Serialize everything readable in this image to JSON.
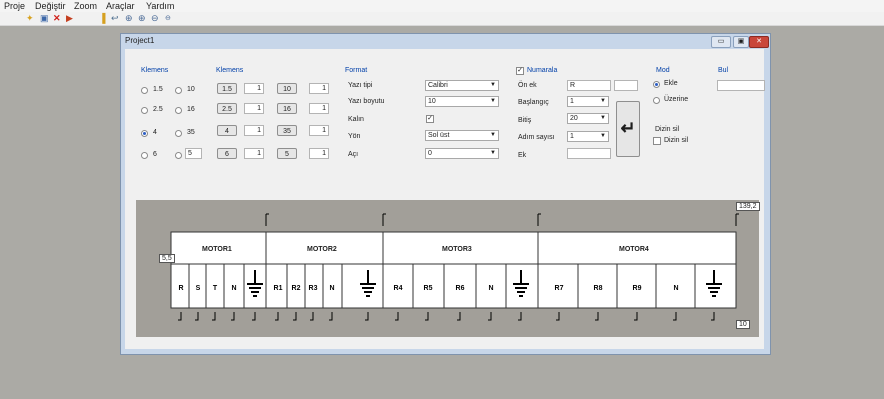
{
  "menu": [
    "Proje",
    "Değiştir",
    "Zoom",
    "Araçlar",
    "Yardım"
  ],
  "toolbar": {
    "icons": [
      "new-icon",
      "save-icon",
      "delete-icon",
      "exit-icon",
      "paste-icon",
      "arrow-icon",
      "zoom-in-icon",
      "zoom-reset-icon",
      "zoom-out-icon",
      "zoom-small-icon"
    ]
  },
  "window": {
    "title": "Project1",
    "btn_min": "▭",
    "btn_max": "▣",
    "btn_close": "✕"
  },
  "klemens1": {
    "header": "Klemens",
    "rows": [
      {
        "a": "1.5",
        "b": "10",
        "selected": false
      },
      {
        "a": "2.5",
        "b": "16",
        "selected": false
      },
      {
        "a": "4",
        "b": "35",
        "selected": true
      },
      {
        "a": "6",
        "b": "5",
        "selected": false
      }
    ]
  },
  "klemens2": {
    "header": "Klemens",
    "rows": [
      {
        "btn1": "1.5",
        "v1": "1",
        "btn2": "10",
        "v2": "1"
      },
      {
        "btn1": "2.5",
        "v1": "1",
        "btn2": "16",
        "v2": "1"
      },
      {
        "btn1": "4",
        "v1": "1",
        "btn2": "35",
        "v2": "1"
      },
      {
        "btn1": "6",
        "v1": "1",
        "btn2": "5",
        "v2": "1"
      }
    ]
  },
  "format": {
    "header": "Format",
    "font_label": "Yazı tipi",
    "font_value": "Calibri",
    "size_label": "Yazı boyutu",
    "size_value": "10",
    "bold_label": "Kalın",
    "bold_checked": "✓",
    "dir_label": "Yön",
    "dir_value": "Sol üst",
    "angle_label": "Açı",
    "angle_value": "0"
  },
  "numbering": {
    "header": "Numarala",
    "checked": "✓",
    "prefix_label": "Ön ek",
    "prefix_value": "R",
    "start_label": "Başlangıç",
    "start_value": "1",
    "end_label": "Bitiş",
    "end_value": "20",
    "step_label": "Adım sayısı",
    "step_value": "1",
    "suffix_label": "Ek",
    "suffix_value": "",
    "apply_icon": "↵"
  },
  "mode": {
    "header": "Mod",
    "add": "Ekle",
    "over": "Üzerine",
    "del_label": "Dizin sil",
    "del_check": "Dizin sil"
  },
  "search": {
    "header": "Bul",
    "value": ""
  },
  "diagram": {
    "motors": [
      "MOTOR1",
      "MOTOR2",
      "MOTOR3",
      "MOTOR4"
    ],
    "terminals": [
      "R",
      "S",
      "T",
      "N",
      "R1",
      "R2",
      "R3",
      "N",
      "R4",
      "R5",
      "R6",
      "N",
      "R7",
      "R8",
      "R9",
      "N"
    ],
    "left_tag": "5,5",
    "right_tag": "139,2",
    "bottom_tag": "10"
  }
}
